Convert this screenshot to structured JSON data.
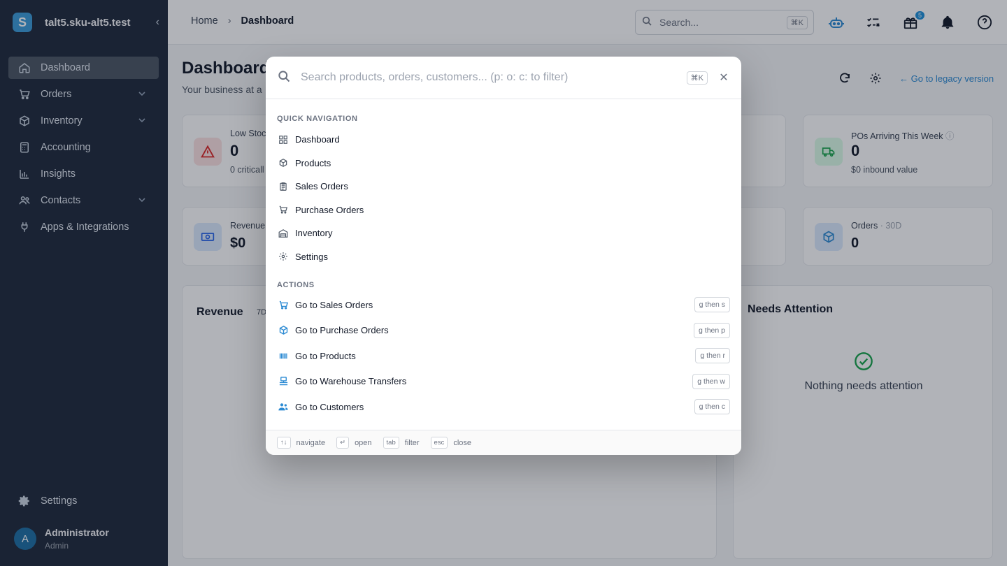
{
  "sidebar": {
    "logo_letter": "S",
    "brand": "talt5.sku-alt5.test",
    "collapse_glyph": "‹",
    "items": [
      {
        "label": "Dashboard",
        "icon": "home-icon",
        "active": true
      },
      {
        "label": "Orders",
        "icon": "cart-icon",
        "expandable": true
      },
      {
        "label": "Inventory",
        "icon": "box-icon",
        "expandable": true
      },
      {
        "label": "Accounting",
        "icon": "calculator-icon"
      },
      {
        "label": "Insights",
        "icon": "bar-chart-icon"
      },
      {
        "label": "Contacts",
        "icon": "users-icon",
        "expandable": true
      },
      {
        "label": "Apps & Integrations",
        "icon": "plug-icon"
      }
    ],
    "settings_label": "Settings",
    "user": {
      "initial": "A",
      "name": "Administrator",
      "role": "Admin"
    }
  },
  "topbar": {
    "breadcrumb": [
      "Home",
      "Dashboard"
    ],
    "search_placeholder": "Search...",
    "search_shortcut": "⌘K",
    "gift_badge": "5",
    "icons": [
      "robot-icon",
      "checklist-icon",
      "gift-icon",
      "bell-icon",
      "help-icon"
    ]
  },
  "page": {
    "title": "Dashboard",
    "subtitle": "Your business at a",
    "legacy_link": "← Go to legacy version"
  },
  "cards": {
    "low_stock": {
      "label": "Low Stoc",
      "value": "0",
      "sub": "0 criticall"
    },
    "pos_arriving": {
      "label": "POs Arriving This Week",
      "value": "0",
      "sub": "$0 inbound value"
    },
    "revenue_kpi": {
      "label": "Revenue",
      "value": "$0"
    },
    "orders_kpi": {
      "label": "Orders",
      "period": "· 30D",
      "value": "0"
    },
    "revenue_chart": {
      "title": "Revenue",
      "range": "7D"
    },
    "needs_attention": {
      "title": "Needs Attention",
      "empty": "Nothing needs attention"
    }
  },
  "palette": {
    "placeholder": "Search products, orders, customers... (p: o: c: to filter)",
    "shortcut": "⌘K",
    "close_glyph": "✕",
    "quick_nav_title": "QUICK NAVIGATION",
    "quick_nav": [
      {
        "label": "Dashboard",
        "icon": "grid-icon"
      },
      {
        "label": "Products",
        "icon": "package-icon"
      },
      {
        "label": "Sales Orders",
        "icon": "clipboard-icon"
      },
      {
        "label": "Purchase Orders",
        "icon": "cart-icon"
      },
      {
        "label": "Inventory",
        "icon": "warehouse-icon"
      },
      {
        "label": "Settings",
        "icon": "gear-icon"
      }
    ],
    "actions_title": "ACTIONS",
    "actions": [
      {
        "label": "Go to Sales Orders",
        "shortcut": "g then s",
        "icon": "cart-icon"
      },
      {
        "label": "Go to Purchase Orders",
        "shortcut": "g then p",
        "icon": "package-icon"
      },
      {
        "label": "Go to Products",
        "shortcut": "g then r",
        "icon": "barcode-icon"
      },
      {
        "label": "Go to Warehouse Transfers",
        "shortcut": "g then w",
        "icon": "transfer-icon"
      },
      {
        "label": "Go to Customers",
        "shortcut": "g then c",
        "icon": "users-icon"
      }
    ],
    "footer": [
      {
        "key": "↑↓",
        "label": "navigate"
      },
      {
        "key": "↵",
        "label": "open"
      },
      {
        "key": "tab",
        "label": "filter"
      },
      {
        "key": "esc",
        "label": "close"
      }
    ]
  },
  "colors": {
    "sidebar_bg": "#1e293b",
    "accent": "#2b8ad3",
    "success": "#16a34a",
    "danger": "#dc2626"
  }
}
